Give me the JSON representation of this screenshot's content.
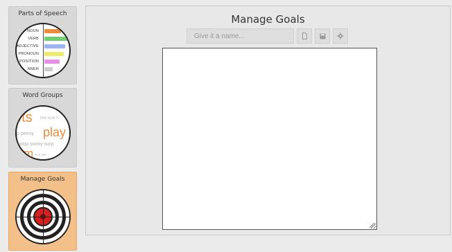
{
  "sidebar": {
    "items": [
      {
        "label": "Parts of Speech",
        "pos_words": [
          "NOUN",
          "VERB",
          "ADJECTIVE",
          "PRONOUN",
          "POSITION",
          "NNER"
        ],
        "pos_colors": [
          "#ef8c3c",
          "#6fd06f",
          "#9ab5f0",
          "#eeea6a",
          "#e690e6",
          "#cccccc"
        ]
      },
      {
        "label": "Word Groups",
        "words": [
          "ets",
          "like look h",
          "p penny",
          "play",
          "e stop sunny surp",
          "m",
          "w w we"
        ]
      },
      {
        "label": "Manage Goals"
      }
    ]
  },
  "main": {
    "title": "Manage Goals",
    "name_placeholder": "Give it a name...",
    "goals_text": ""
  },
  "colors": {
    "accent_active": "#f3c08a",
    "word_orange": "#ef8c3c",
    "target_red": "#d42020"
  }
}
